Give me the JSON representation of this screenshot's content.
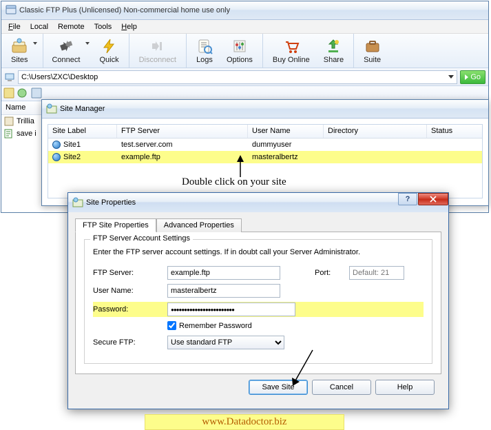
{
  "main_window": {
    "title": "Classic FTP Plus (Unlicensed) Non-commercial home use only",
    "menu": {
      "file": "File",
      "local": "Local",
      "remote": "Remote",
      "tools": "Tools",
      "help": "Help"
    },
    "toolbar": {
      "sites": "Sites",
      "connect": "Connect",
      "quick": "Quick",
      "disconnect": "Disconnect",
      "logs": "Logs",
      "options": "Options",
      "buy": "Buy Online",
      "share": "Share",
      "suite": "Suite"
    },
    "path": "C:\\Users\\ZXC\\Desktop",
    "go": "Go",
    "list_header": {
      "name": "Name"
    },
    "files": [
      {
        "name": "Trillia"
      },
      {
        "name": "save i"
      }
    ]
  },
  "site_manager": {
    "title": "Site Manager",
    "columns": {
      "label": "Site Label",
      "server": "FTP Server",
      "user": "User Name",
      "dir": "Directory",
      "status": "Status"
    },
    "rows": [
      {
        "label": "Site1",
        "server": "test.server.com",
        "user": "dummyuser",
        "dir": "",
        "status": ""
      },
      {
        "label": "Site2",
        "server": "example.ftp",
        "user": "masteralbertz",
        "dir": "",
        "status": ""
      }
    ]
  },
  "annotation1": "Double click on your site",
  "site_props": {
    "title": "Site Properties",
    "tabs": {
      "ftp": "FTP Site Properties",
      "adv": "Advanced Properties"
    },
    "group_legend": "FTP Server Account Settings",
    "desc": "Enter the FTP server account settings. If in doubt call your Server Administrator.",
    "labels": {
      "server": "FTP Server:",
      "port": "Port:",
      "port_placeholder": "Default: 21",
      "user": "User Name:",
      "pass": "Password:",
      "remember": "Remember Password",
      "secure": "Secure FTP:"
    },
    "values": {
      "server": "example.ftp",
      "user": "masteralbertz",
      "pass": "●●●●●●●●●●●●●●●●●●●●●●●●",
      "secure": "Use standard FTP"
    },
    "remember_checked": true,
    "buttons": {
      "save": "Save Site",
      "cancel": "Cancel",
      "help": "Help"
    }
  },
  "footer": "www.Datadoctor.biz"
}
